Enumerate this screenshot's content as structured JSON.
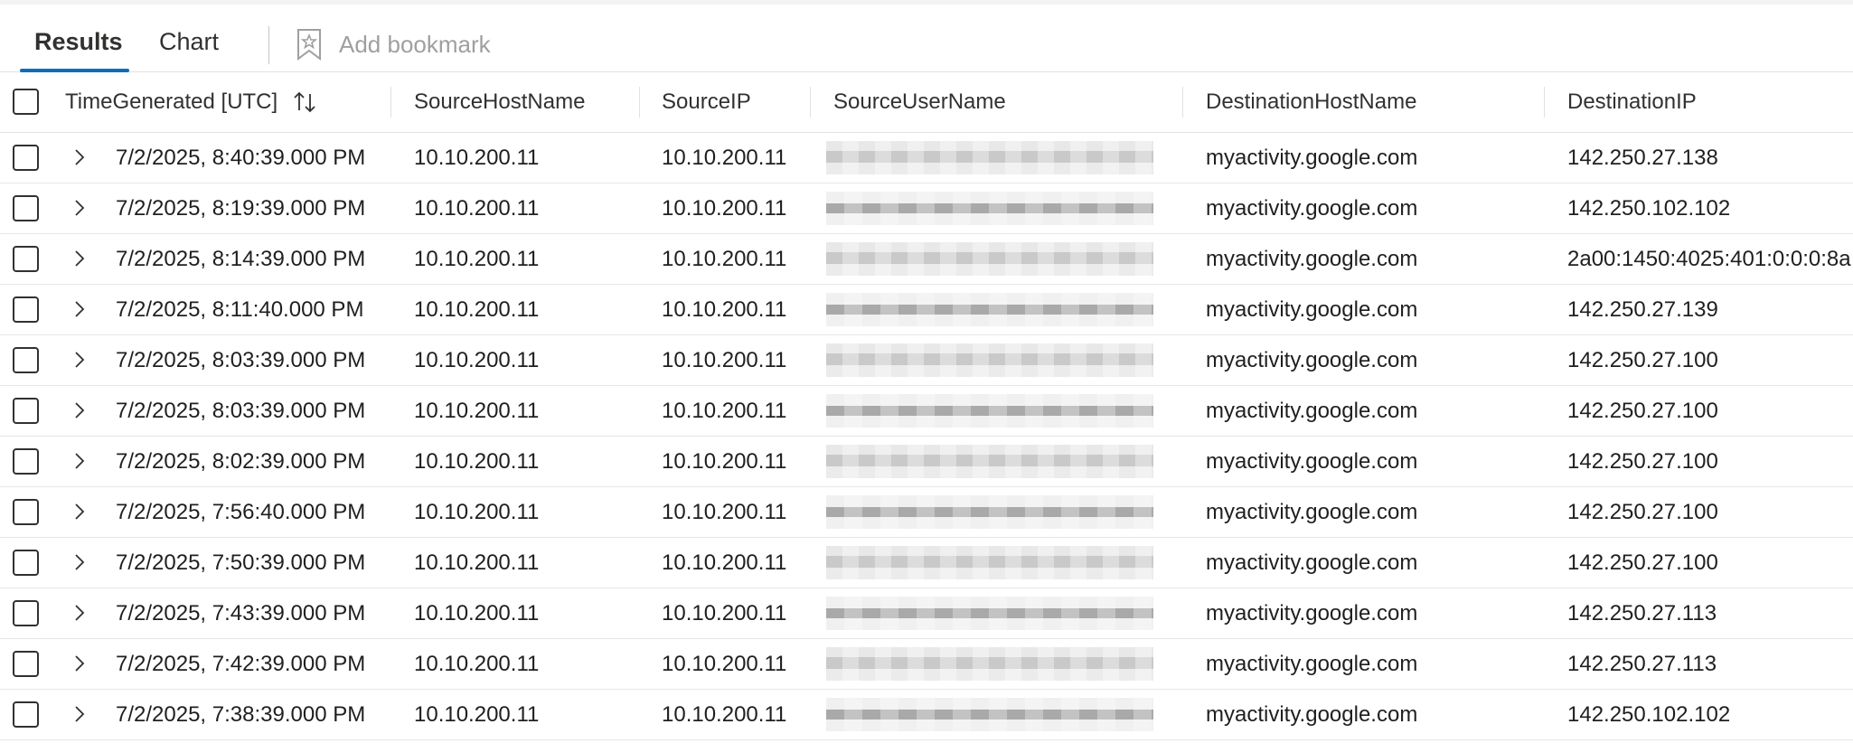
{
  "tabs": {
    "results": "Results",
    "chart": "Chart",
    "bookmark": "Add bookmark"
  },
  "columns": {
    "time": "TimeGenerated [UTC]",
    "src_host": "SourceHostName",
    "src_ip": "SourceIP",
    "src_user": "SourceUserName",
    "dst_host": "DestinationHostName",
    "dst_ip": "DestinationIP"
  },
  "rows": [
    {
      "time": "7/2/2025, 8:40:39.000 PM",
      "src_host": "10.10.200.11",
      "src_ip": "10.10.200.11",
      "dst_host": "myactivity.google.com",
      "dst_ip": "142.250.27.138"
    },
    {
      "time": "7/2/2025, 8:19:39.000 PM",
      "src_host": "10.10.200.11",
      "src_ip": "10.10.200.11",
      "dst_host": "myactivity.google.com",
      "dst_ip": "142.250.102.102"
    },
    {
      "time": "7/2/2025, 8:14:39.000 PM",
      "src_host": "10.10.200.11",
      "src_ip": "10.10.200.11",
      "dst_host": "myactivity.google.com",
      "dst_ip": "2a00:1450:4025:401:0:0:0:8a"
    },
    {
      "time": "7/2/2025, 8:11:40.000 PM",
      "src_host": "10.10.200.11",
      "src_ip": "10.10.200.11",
      "dst_host": "myactivity.google.com",
      "dst_ip": "142.250.27.139"
    },
    {
      "time": "7/2/2025, 8:03:39.000 PM",
      "src_host": "10.10.200.11",
      "src_ip": "10.10.200.11",
      "dst_host": "myactivity.google.com",
      "dst_ip": "142.250.27.100"
    },
    {
      "time": "7/2/2025, 8:03:39.000 PM",
      "src_host": "10.10.200.11",
      "src_ip": "10.10.200.11",
      "dst_host": "myactivity.google.com",
      "dst_ip": "142.250.27.100"
    },
    {
      "time": "7/2/2025, 8:02:39.000 PM",
      "src_host": "10.10.200.11",
      "src_ip": "10.10.200.11",
      "dst_host": "myactivity.google.com",
      "dst_ip": "142.250.27.100"
    },
    {
      "time": "7/2/2025, 7:56:40.000 PM",
      "src_host": "10.10.200.11",
      "src_ip": "10.10.200.11",
      "dst_host": "myactivity.google.com",
      "dst_ip": "142.250.27.100"
    },
    {
      "time": "7/2/2025, 7:50:39.000 PM",
      "src_host": "10.10.200.11",
      "src_ip": "10.10.200.11",
      "dst_host": "myactivity.google.com",
      "dst_ip": "142.250.27.100"
    },
    {
      "time": "7/2/2025, 7:43:39.000 PM",
      "src_host": "10.10.200.11",
      "src_ip": "10.10.200.11",
      "dst_host": "myactivity.google.com",
      "dst_ip": "142.250.27.113"
    },
    {
      "time": "7/2/2025, 7:42:39.000 PM",
      "src_host": "10.10.200.11",
      "src_ip": "10.10.200.11",
      "dst_host": "myactivity.google.com",
      "dst_ip": "142.250.27.113"
    },
    {
      "time": "7/2/2025, 7:38:39.000 PM",
      "src_host": "10.10.200.11",
      "src_ip": "10.10.200.11",
      "dst_host": "myactivity.google.com",
      "dst_ip": "142.250.102.102"
    }
  ]
}
